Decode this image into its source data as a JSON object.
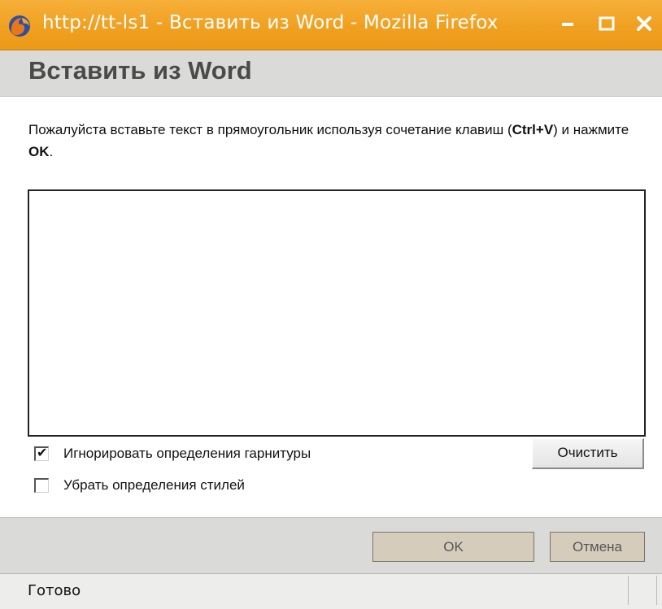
{
  "window": {
    "title": "http://tt-ls1 - Вставить из Word - Mozilla Firefox",
    "icon": "firefox-icon",
    "controls": [
      "minimize-icon",
      "maximize-icon",
      "close-icon"
    ],
    "accent_color": "#f0a020"
  },
  "dialog": {
    "title": "Вставить из Word",
    "instructions": {
      "part1": "Пожалуйста вставьте текст в прямоугольник используя сочетание клавиш (",
      "shortcut": "Ctrl+V",
      "part2": ") и нажмите ",
      "ok_word": "OK",
      "part3": "."
    },
    "paste_area_value": "",
    "options": [
      {
        "label": "Игнорировать определения гарнитуры",
        "checked": true
      },
      {
        "label": "Убрать определения стилей",
        "checked": false
      }
    ],
    "clear_label": "Очистить",
    "ok_label": "OK",
    "cancel_label": "Отмена"
  },
  "statusbar": {
    "text": "Готово"
  }
}
